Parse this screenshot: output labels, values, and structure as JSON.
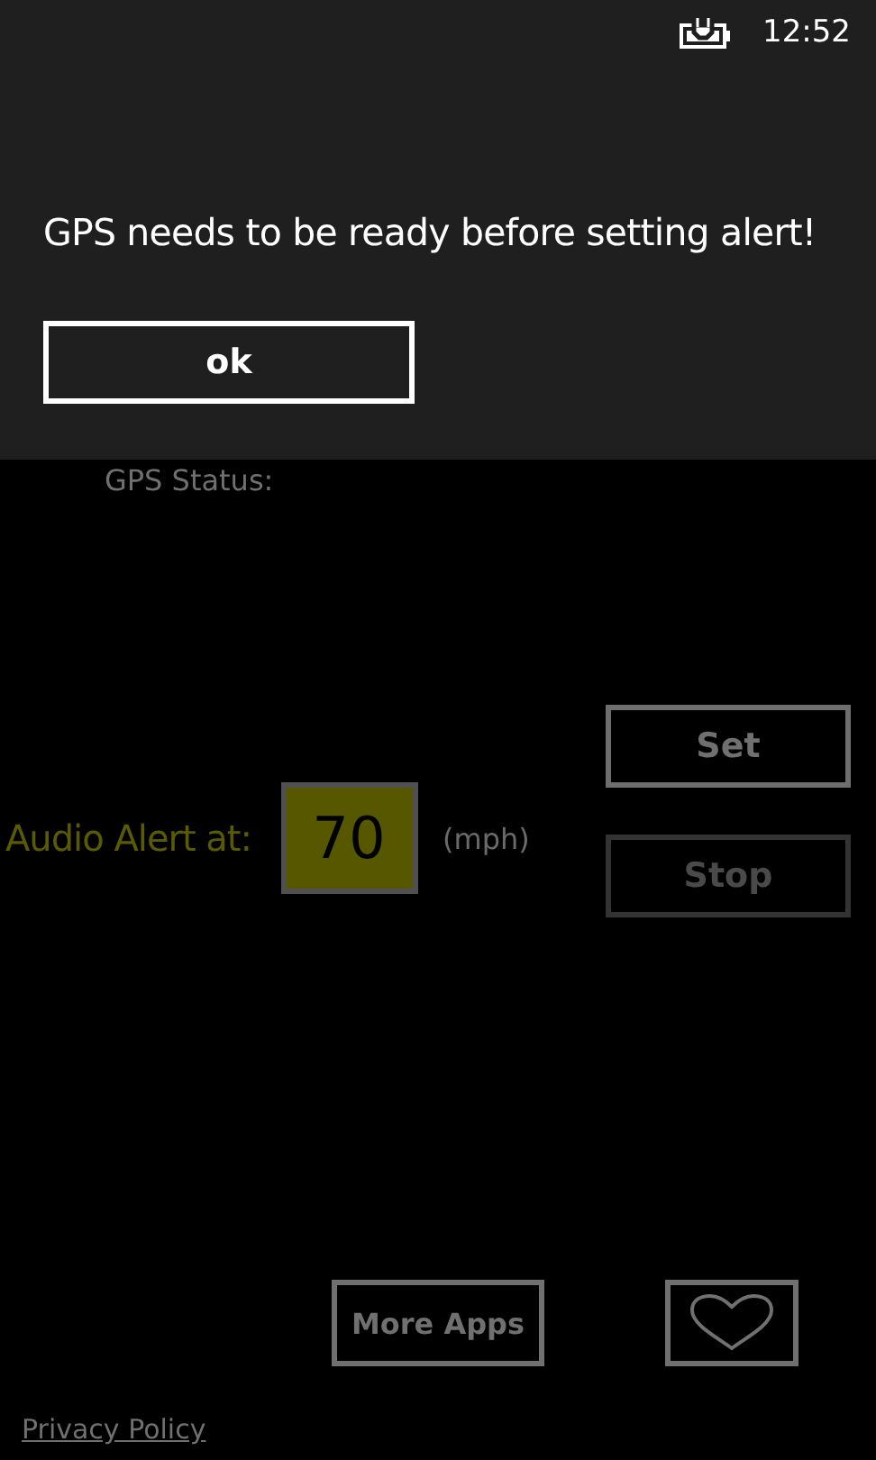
{
  "status_bar": {
    "battery_charging": true,
    "time": "12:52"
  },
  "dialog": {
    "message": "GPS needs to be ready before setting alert!",
    "button": "ok"
  },
  "gps_status": {
    "label": "GPS Status:"
  },
  "alert": {
    "label": "Audio Alert at:",
    "value": "70",
    "unit": "(mph)"
  },
  "actions": [
    {
      "label": "Set",
      "disabled": false
    },
    {
      "label": "Stop",
      "disabled": true
    }
  ],
  "footer": {
    "more_apps": "More Apps",
    "privacy_link": "Privacy Policy"
  }
}
